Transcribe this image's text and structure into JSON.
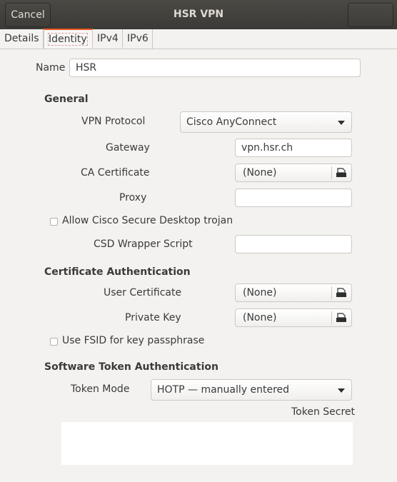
{
  "window": {
    "title": "HSR VPN",
    "cancel_label": "Cancel",
    "save_label": ""
  },
  "tabs": [
    {
      "label": "Details"
    },
    {
      "label": "Identity"
    },
    {
      "label": "IPv4"
    },
    {
      "label": "IPv6"
    }
  ],
  "name": {
    "label": "Name",
    "value": "HSR"
  },
  "general": {
    "heading": "General",
    "vpn_protocol_label": "VPN Protocol",
    "vpn_protocol_value": "Cisco AnyConnect",
    "gateway_label": "Gateway",
    "gateway_value": "vpn.hsr.ch",
    "ca_cert_label": "CA Certificate",
    "ca_cert_value": "(None)",
    "proxy_label": "Proxy",
    "proxy_value": "",
    "allow_csd_label": "Allow Cisco Secure Desktop trojan",
    "allow_csd_checked": false,
    "csd_wrapper_label": "CSD Wrapper Script",
    "csd_wrapper_value": ""
  },
  "cert_auth": {
    "heading": "Certificate Authentication",
    "user_cert_label": "User Certificate",
    "user_cert_value": "(None)",
    "private_key_label": "Private Key",
    "private_key_value": "(None)",
    "use_fsid_label": "Use FSID for key passphrase",
    "use_fsid_checked": false
  },
  "token_auth": {
    "heading": "Software Token Authentication",
    "token_mode_label": "Token Mode",
    "token_mode_value": "HOTP — manually entered",
    "token_secret_label": "Token Secret",
    "token_secret_value": ""
  },
  "colors": {
    "titlebar": "#3b3a36",
    "accent": "#e95420",
    "background": "#f3f2f0"
  }
}
